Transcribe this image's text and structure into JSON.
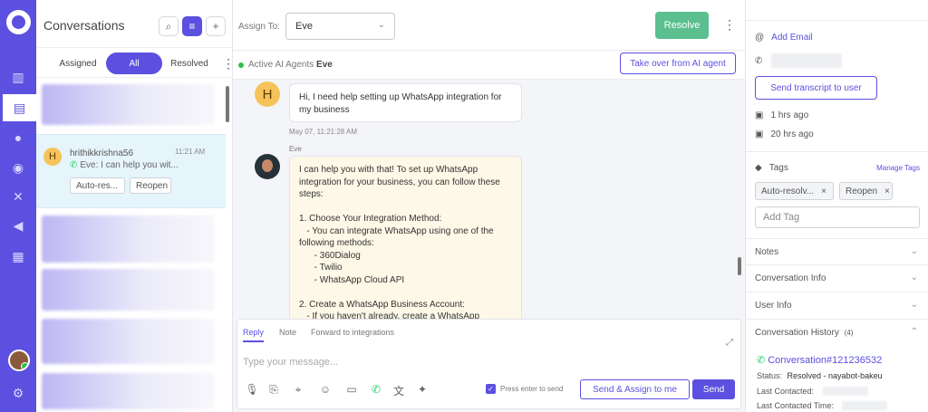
{
  "rail": {
    "items": [
      "reports-icon",
      "conversations-icon",
      "contacts-icon",
      "bot-icon",
      "integrations-icon",
      "campaigns-icon",
      "documents-icon"
    ]
  },
  "convlist": {
    "title": "Conversations",
    "tabs": {
      "assigned": "Assigned",
      "all": "All",
      "resolved": "Resolved"
    },
    "selected": {
      "avatar": "H",
      "name": "hrithikkrishna56",
      "time": "11:21 AM",
      "preview": "Eve: I can help you wit...",
      "labels": [
        "Auto-res...",
        "Reopen"
      ]
    }
  },
  "chat": {
    "assign_label": "Assign To:",
    "assignee": "Eve",
    "resolve_label": "Resolve",
    "active_agents_label": "Active AI Agents",
    "active_agent": "Eve",
    "takeover_label": "Take over from AI agent",
    "messages": [
      {
        "avatar": "H",
        "text": "Hi, I need help setting up WhatsApp integration for my business",
        "time": "May 07, 11:21:28 AM"
      },
      {
        "sender": "Eve",
        "text": "I can help you with that! To set up WhatsApp integration for your business, you can follow these steps:\n\n1. Choose Your Integration Method:\n   - You can integrate WhatsApp using one of the following methods:\n      - 360Dialog\n      - Twilio\n      - WhatsApp Cloud API\n\n2. Create a WhatsApp Business Account:\n   - If you haven't already, create a WhatsApp"
      }
    ],
    "composer": {
      "tabs": [
        "Reply",
        "Note",
        "Forward to integrations"
      ],
      "placeholder": "Type your message...",
      "press_enter": "Press enter to send",
      "send_assign": "Send & Assign to me",
      "send": "Send"
    }
  },
  "right": {
    "add_email": "Add Email",
    "transcript": "Send transcript to user",
    "times": [
      "1 hrs ago",
      "20 hrs ago"
    ],
    "tags_title": "Tags",
    "manage_tags": "Manage Tags",
    "tags": [
      "Auto-resolv...",
      "Reopen"
    ],
    "add_tag": "Add Tag",
    "sections": [
      "Notes",
      "Conversation Info",
      "User Info"
    ],
    "history_title": "Conversation History",
    "history_count": "(4)",
    "conversation_id": "Conversation#121236532",
    "status_label": "Status:",
    "status_value": "Resolved - nayabot-bakeu",
    "last_contacted": "Last Contacted:",
    "last_contacted_time": "Last Contacted Time:"
  },
  "colors": {
    "accent": "#5b50e0",
    "resolve": "#5bbf8f",
    "bot_bubble": "#fdf8e7",
    "selected_row": "#e6f4fb"
  }
}
